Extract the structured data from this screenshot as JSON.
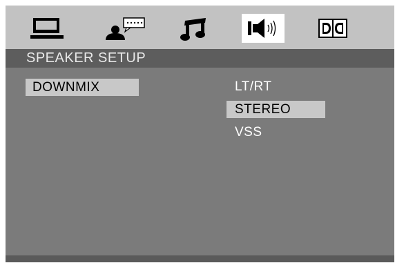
{
  "section_title": "SPEAKER SETUP",
  "menu": {
    "selected_item": "DOWNMIX"
  },
  "options": [
    {
      "label": "LT/RT",
      "selected": false
    },
    {
      "label": "STEREO",
      "selected": true
    },
    {
      "label": "VSS",
      "selected": false
    }
  ],
  "tabs": [
    {
      "icon": "monitor-icon",
      "active": false
    },
    {
      "icon": "user-speech-icon",
      "active": false
    },
    {
      "icon": "music-note-icon",
      "active": false
    },
    {
      "icon": "speaker-icon",
      "active": true
    },
    {
      "icon": "dolby-icon",
      "active": false
    }
  ],
  "colors": {
    "icon_bar": "#c2c2c2",
    "section_bar": "#5d5d5d",
    "background": "#7b7b7b",
    "highlight": "#c8c8c8",
    "active_tab": "#ffffff"
  }
}
